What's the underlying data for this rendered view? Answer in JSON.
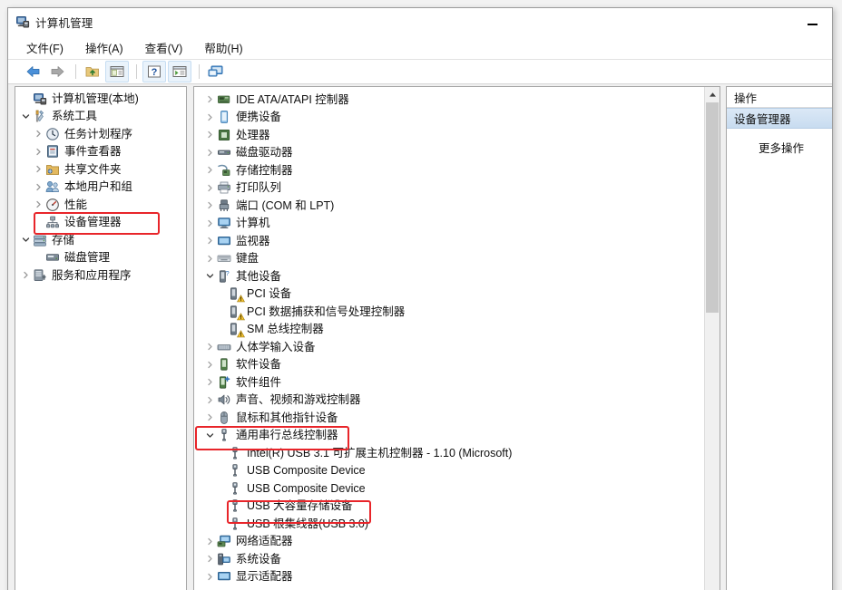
{
  "window": {
    "title": "计算机管理",
    "icon": "computer-management-icon",
    "minimize_label": "最小化"
  },
  "menubar": {
    "items": [
      {
        "label": "文件(F)",
        "key": "F",
        "text": "文件"
      },
      {
        "label": "操作(A)",
        "key": "A",
        "text": "操作"
      },
      {
        "label": "查看(V)",
        "key": "V",
        "text": "查看"
      },
      {
        "label": "帮助(H)",
        "key": "H",
        "text": "帮助"
      }
    ]
  },
  "toolbar": {
    "buttons": [
      {
        "name": "back-icon",
        "label": "后退"
      },
      {
        "name": "forward-icon",
        "label": "前进"
      },
      {
        "name": "up-folder-icon",
        "label": "上移一级"
      },
      {
        "name": "show-hide-console-tree-icon",
        "label": "显示/隐藏控制台树"
      },
      {
        "name": "help-icon",
        "label": "帮助"
      },
      {
        "name": "show-hide-action-pane-icon",
        "label": "显示/隐藏操作窗格"
      },
      {
        "name": "properties-icon",
        "label": "属性"
      }
    ]
  },
  "left_tree": {
    "items": [
      {
        "label": "计算机管理(本地)",
        "depth": 0,
        "expander": "none",
        "icon": "computer-icon",
        "highlight": false
      },
      {
        "label": "系统工具",
        "depth": 0,
        "expander": "expanded",
        "icon": "tools-icon",
        "highlight": false
      },
      {
        "label": "任务计划程序",
        "depth": 1,
        "expander": "collapsed",
        "icon": "clock-icon",
        "highlight": false
      },
      {
        "label": "事件查看器",
        "depth": 1,
        "expander": "collapsed",
        "icon": "event-log-icon",
        "highlight": false
      },
      {
        "label": "共享文件夹",
        "depth": 1,
        "expander": "collapsed",
        "icon": "shared-folder-icon",
        "highlight": false
      },
      {
        "label": "本地用户和组",
        "depth": 1,
        "expander": "collapsed",
        "icon": "users-icon",
        "highlight": false
      },
      {
        "label": "性能",
        "depth": 1,
        "expander": "collapsed",
        "icon": "performance-icon",
        "highlight": false
      },
      {
        "label": "设备管理器",
        "depth": 1,
        "expander": "none",
        "icon": "device-manager-icon",
        "highlight": true
      },
      {
        "label": "存储",
        "depth": 0,
        "expander": "expanded",
        "icon": "storage-icon",
        "highlight": false
      },
      {
        "label": "磁盘管理",
        "depth": 1,
        "expander": "none",
        "icon": "disk-management-icon",
        "highlight": false
      },
      {
        "label": "服务和应用程序",
        "depth": 0,
        "expander": "collapsed",
        "icon": "services-icon",
        "highlight": false
      }
    ]
  },
  "device_tree": {
    "items": [
      {
        "label": "IDE ATA/ATAPI 控制器",
        "depth": 0,
        "expander": "collapsed",
        "icon": "ide-controller-icon",
        "warning": false
      },
      {
        "label": "便携设备",
        "depth": 0,
        "expander": "collapsed",
        "icon": "portable-device-icon",
        "warning": false
      },
      {
        "label": "处理器",
        "depth": 0,
        "expander": "collapsed",
        "icon": "processor-icon",
        "warning": false
      },
      {
        "label": "磁盘驱动器",
        "depth": 0,
        "expander": "collapsed",
        "icon": "disk-drive-icon",
        "warning": false
      },
      {
        "label": "存储控制器",
        "depth": 0,
        "expander": "collapsed",
        "icon": "storage-controller-icon",
        "warning": false
      },
      {
        "label": "打印队列",
        "depth": 0,
        "expander": "collapsed",
        "icon": "print-queue-icon",
        "warning": false
      },
      {
        "label": "端口 (COM 和 LPT)",
        "depth": 0,
        "expander": "collapsed",
        "icon": "ports-icon",
        "warning": false
      },
      {
        "label": "计算机",
        "depth": 0,
        "expander": "collapsed",
        "icon": "computer-icon",
        "warning": false
      },
      {
        "label": "监视器",
        "depth": 0,
        "expander": "collapsed",
        "icon": "monitor-icon",
        "warning": false
      },
      {
        "label": "键盘",
        "depth": 0,
        "expander": "collapsed",
        "icon": "keyboard-icon",
        "warning": false
      },
      {
        "label": "其他设备",
        "depth": 0,
        "expander": "expanded",
        "icon": "unknown-device-icon",
        "warning": false
      },
      {
        "label": "PCI 设备",
        "depth": 1,
        "expander": "none",
        "icon": "unknown-device-icon",
        "warning": true
      },
      {
        "label": "PCI 数据捕获和信号处理控制器",
        "depth": 1,
        "expander": "none",
        "icon": "unknown-device-icon",
        "warning": true
      },
      {
        "label": "SM 总线控制器",
        "depth": 1,
        "expander": "none",
        "icon": "unknown-device-icon",
        "warning": true
      },
      {
        "label": "人体学输入设备",
        "depth": 0,
        "expander": "collapsed",
        "icon": "hid-icon",
        "warning": false
      },
      {
        "label": "软件设备",
        "depth": 0,
        "expander": "collapsed",
        "icon": "software-device-icon",
        "warning": false
      },
      {
        "label": "软件组件",
        "depth": 0,
        "expander": "collapsed",
        "icon": "software-component-icon",
        "warning": false
      },
      {
        "label": "声音、视频和游戏控制器",
        "depth": 0,
        "expander": "collapsed",
        "icon": "sound-video-game-icon",
        "warning": false
      },
      {
        "label": "鼠标和其他指针设备",
        "depth": 0,
        "expander": "collapsed",
        "icon": "mouse-icon",
        "warning": false
      },
      {
        "label": "通用串行总线控制器",
        "depth": 0,
        "expander": "expanded",
        "icon": "usb-icon",
        "warning": false
      },
      {
        "label": "Intel(R) USB 3.1 可扩展主机控制器 - 1.10 (Microsoft)",
        "depth": 1,
        "expander": "none",
        "icon": "usb-icon",
        "warning": false
      },
      {
        "label": "USB Composite Device",
        "depth": 1,
        "expander": "none",
        "icon": "usb-icon",
        "warning": false
      },
      {
        "label": "USB Composite Device",
        "depth": 1,
        "expander": "none",
        "icon": "usb-icon",
        "warning": false
      },
      {
        "label": "USB 大容量存储设备",
        "depth": 1,
        "expander": "none",
        "icon": "usb-icon",
        "warning": false
      },
      {
        "label": "USB 根集线器(USB 3.0)",
        "depth": 1,
        "expander": "none",
        "icon": "usb-icon",
        "warning": false
      },
      {
        "label": "网络适配器",
        "depth": 0,
        "expander": "collapsed",
        "icon": "network-adapter-icon",
        "warning": false
      },
      {
        "label": "系统设备",
        "depth": 0,
        "expander": "collapsed",
        "icon": "system-device-icon",
        "warning": false
      },
      {
        "label": "显示适配器",
        "depth": 0,
        "expander": "collapsed",
        "icon": "display-adapter-icon",
        "warning": false
      }
    ]
  },
  "action_pane": {
    "header": "操作",
    "selected": "设备管理器",
    "more_actions": "更多操作"
  },
  "annotations": {
    "color": "#e8252a",
    "boxes": [
      {
        "target": "设备管理器",
        "pane": "left"
      },
      {
        "target": "通用串行总线控制器",
        "pane": "device"
      },
      {
        "target": "USB 大容量存储设备",
        "pane": "device"
      }
    ]
  }
}
